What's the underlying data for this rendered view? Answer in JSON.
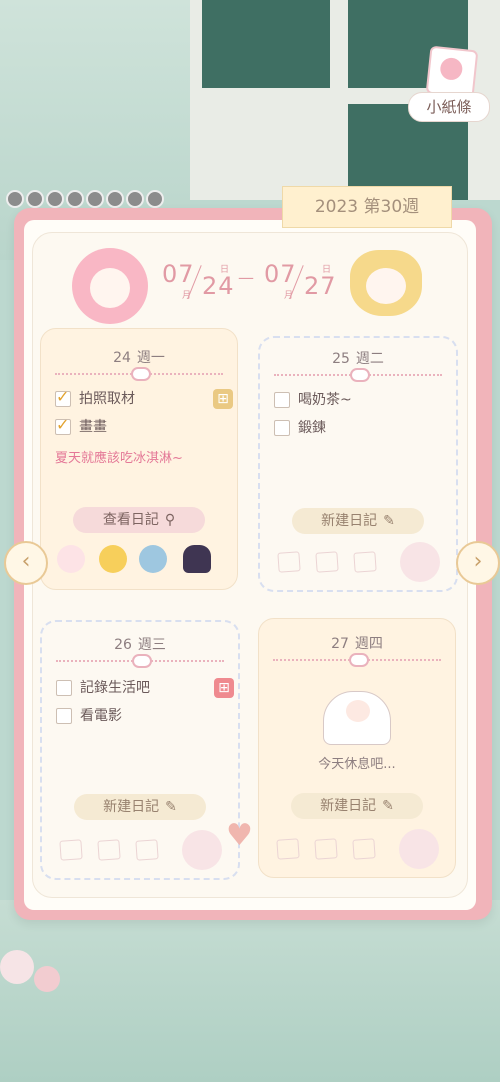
{
  "header": {
    "week_label": "2023 第30週",
    "notes_chip": "小紙條"
  },
  "date_range": {
    "start_month": "07",
    "start_month_suffix": "月",
    "start_day": "24",
    "start_day_suffix": "日",
    "end_month": "07",
    "end_month_suffix": "月",
    "end_day": "27",
    "end_day_suffix": "日",
    "separator": "—"
  },
  "days": [
    {
      "num": "24",
      "weekday": "週一",
      "tasks": [
        {
          "label": "拍照取材",
          "checked": true
        },
        {
          "label": "畫畫",
          "checked": true
        }
      ],
      "memo": "夏天就應該吃冰淇淋~",
      "button": "查看日記",
      "stickers": [
        "blush-face-sticker",
        "sun-sticker",
        "landscape-sticker",
        "dress-sticker"
      ]
    },
    {
      "num": "25",
      "weekday": "週二",
      "tasks": [
        {
          "label": "喝奶茶~",
          "checked": false
        },
        {
          "label": "鍛鍊",
          "checked": false
        }
      ],
      "button": "新建日記"
    },
    {
      "num": "26",
      "weekday": "週三",
      "tasks": [
        {
          "label": "記錄生活吧",
          "checked": false
        },
        {
          "label": "看電影",
          "checked": false
        }
      ],
      "button": "新建日記"
    },
    {
      "num": "27",
      "weekday": "週四",
      "rest_text": "今天休息吧...",
      "button": "新建日記"
    }
  ],
  "nav": {
    "prev_icon": "chevron-left-icon",
    "next_icon": "chevron-right-icon",
    "prev_glyph": "‹",
    "next_glyph": "›"
  },
  "icons": {
    "search": "search-icon",
    "edit": "edit-icon",
    "gift": "gift-icon"
  },
  "colors": {
    "book_edge": "#f1b4ba",
    "accent_pink": "#e47897",
    "check_gold": "#e2a330",
    "week_tab": "#fff0cf"
  }
}
